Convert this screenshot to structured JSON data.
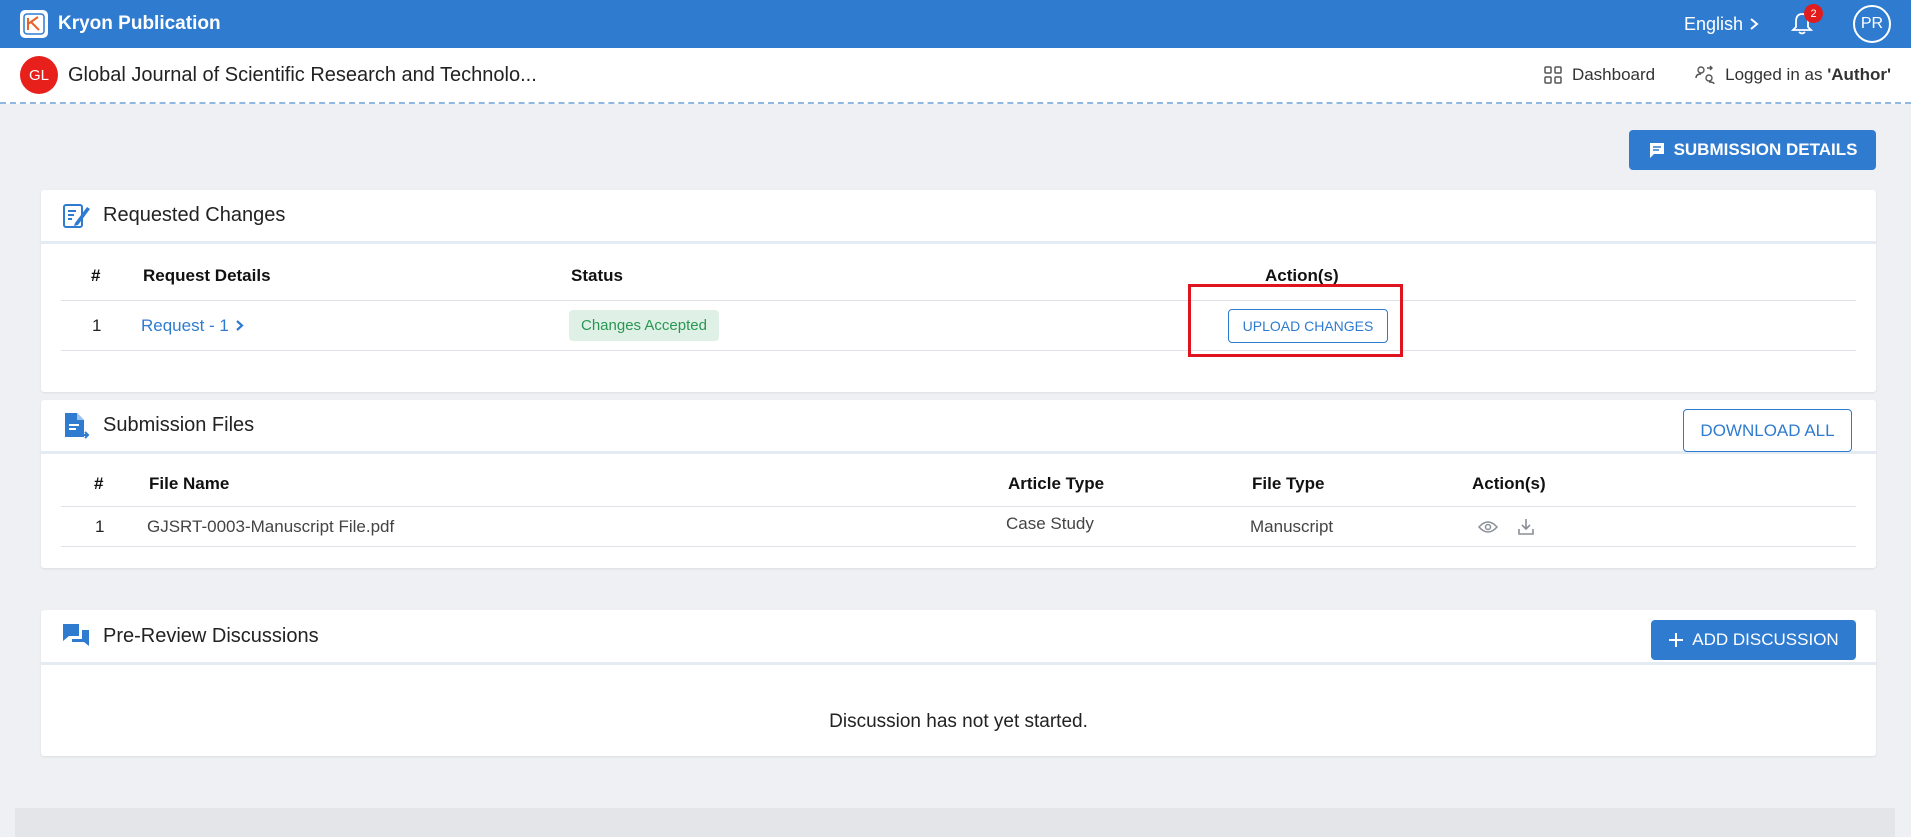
{
  "app": {
    "title": "Kryon Publication"
  },
  "topbar": {
    "language": "English",
    "notifications_count": "2",
    "avatar_initials": "PR"
  },
  "journal": {
    "badge": "GL",
    "title": "Global Journal of Scientific Research and Technolo...",
    "dashboard_label": "Dashboard",
    "logged_in_prefix": "Logged in as ",
    "logged_in_role": "'Author'"
  },
  "actions": {
    "submission_details_label": "SUBMISSION DETAILS"
  },
  "requested_changes": {
    "title": "Requested Changes",
    "columns": [
      "#",
      "Request Details",
      "Status",
      "Action(s)"
    ],
    "rows": [
      {
        "num": "1",
        "request": "Request - 1",
        "status": "Changes Accepted",
        "action": "UPLOAD CHANGES"
      }
    ]
  },
  "submission_files": {
    "title": "Submission Files",
    "download_all_label": "DOWNLOAD ALL",
    "columns": [
      "#",
      "File Name",
      "Article Type",
      "File Type",
      "Action(s)"
    ],
    "rows": [
      {
        "num": "1",
        "file_name": "GJSRT-0003-Manuscript File.pdf",
        "article_type": "Case Study",
        "file_type": "Manuscript"
      }
    ]
  },
  "discussions": {
    "title": "Pre-Review Discussions",
    "add_label": "ADD DISCUSSION",
    "empty_message": "Discussion has not yet started."
  },
  "colors": {
    "primary": "#2f7bd0",
    "highlight": "#e0141e",
    "status_bg": "#dff1e6",
    "status_text": "#2a9653",
    "badge_red": "#e8201c"
  }
}
